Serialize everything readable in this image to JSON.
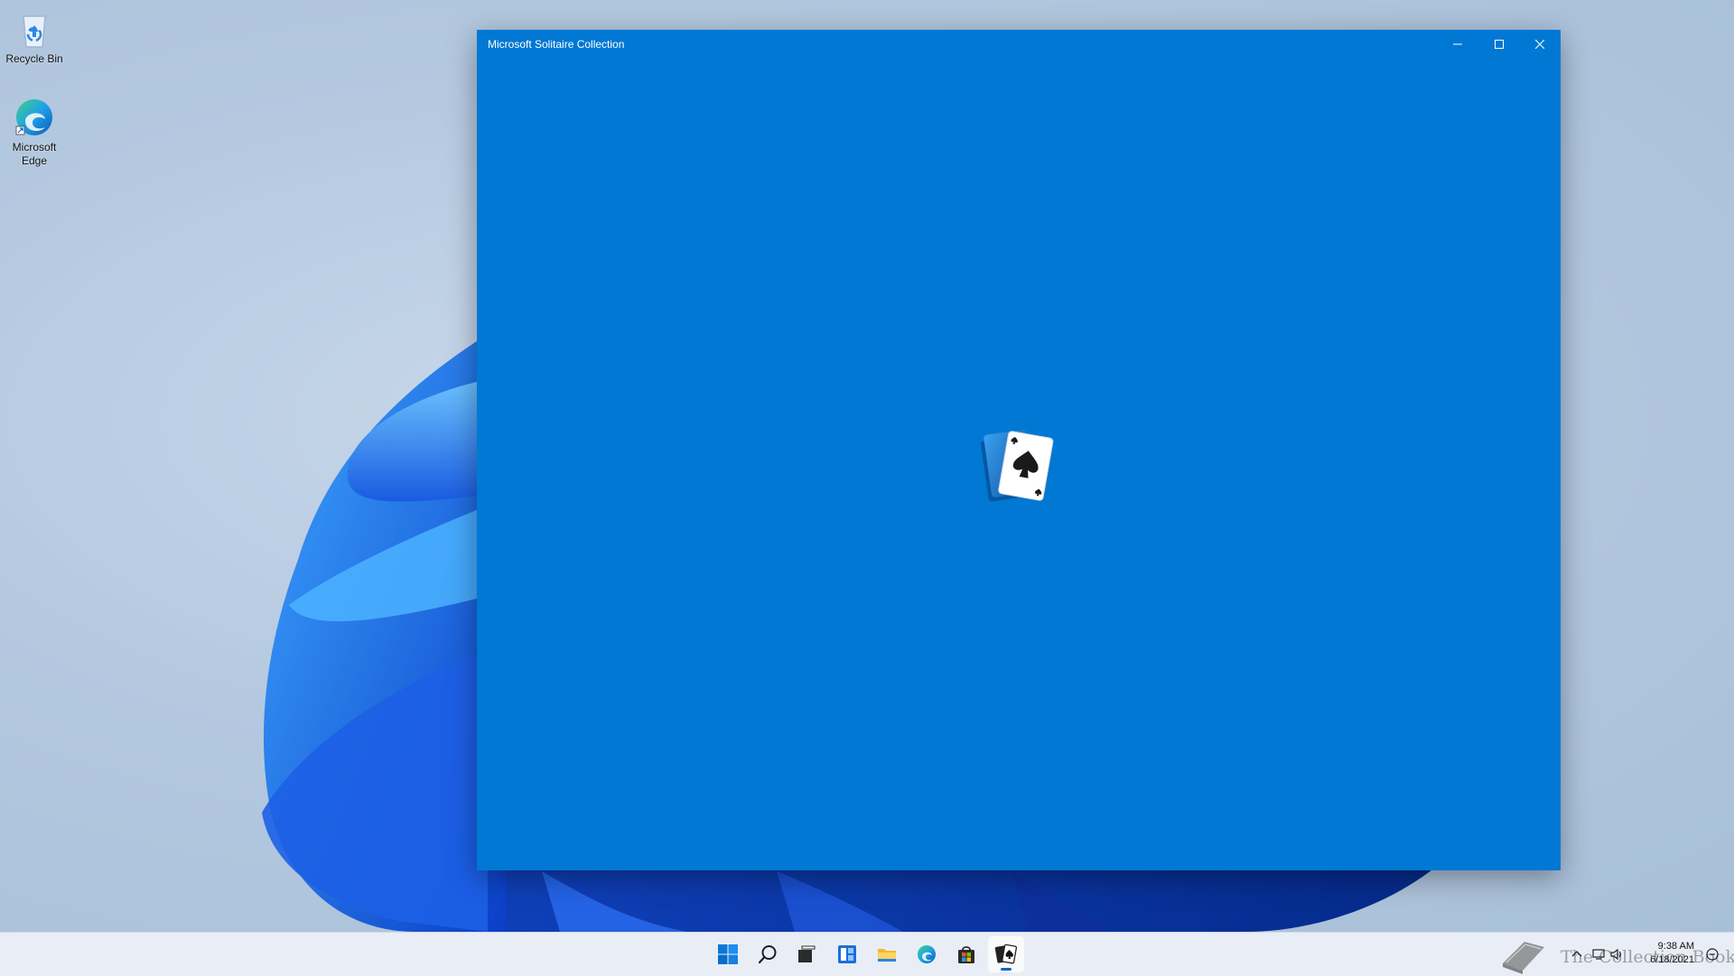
{
  "desktop": {
    "icons": [
      {
        "label": "Recycle Bin",
        "icon": "recycle-bin-icon"
      },
      {
        "label": "Microsoft Edge",
        "icon": "edge-icon"
      }
    ]
  },
  "window": {
    "title": "Microsoft Solitaire Collection",
    "background": "#0078d4",
    "buttons": {
      "minimize": "minimize-icon",
      "maximize": "maximize-icon",
      "close": "close-icon"
    },
    "splash_icon": "solitaire-spade-cards-icon"
  },
  "taskbar": {
    "apps": [
      {
        "name": "Start",
        "icon": "windows-start-icon"
      },
      {
        "name": "Search",
        "icon": "search-icon"
      },
      {
        "name": "Task View",
        "icon": "task-view-icon"
      },
      {
        "name": "Widgets",
        "icon": "widgets-icon"
      },
      {
        "name": "File Explorer",
        "icon": "folder-icon"
      },
      {
        "name": "Microsoft Edge",
        "icon": "edge-icon"
      },
      {
        "name": "Microsoft Store",
        "icon": "store-icon"
      },
      {
        "name": "Microsoft Solitaire Collection",
        "icon": "solitaire-icon",
        "active": true
      }
    ],
    "tray": {
      "time": "9:38 AM",
      "date": "6/18/2021",
      "icons": [
        "chevron-up-icon",
        "network-icon",
        "volume-icon",
        "notification-icon"
      ]
    },
    "accent": "#0067c0"
  },
  "watermark": {
    "text": "The Collection Book"
  }
}
